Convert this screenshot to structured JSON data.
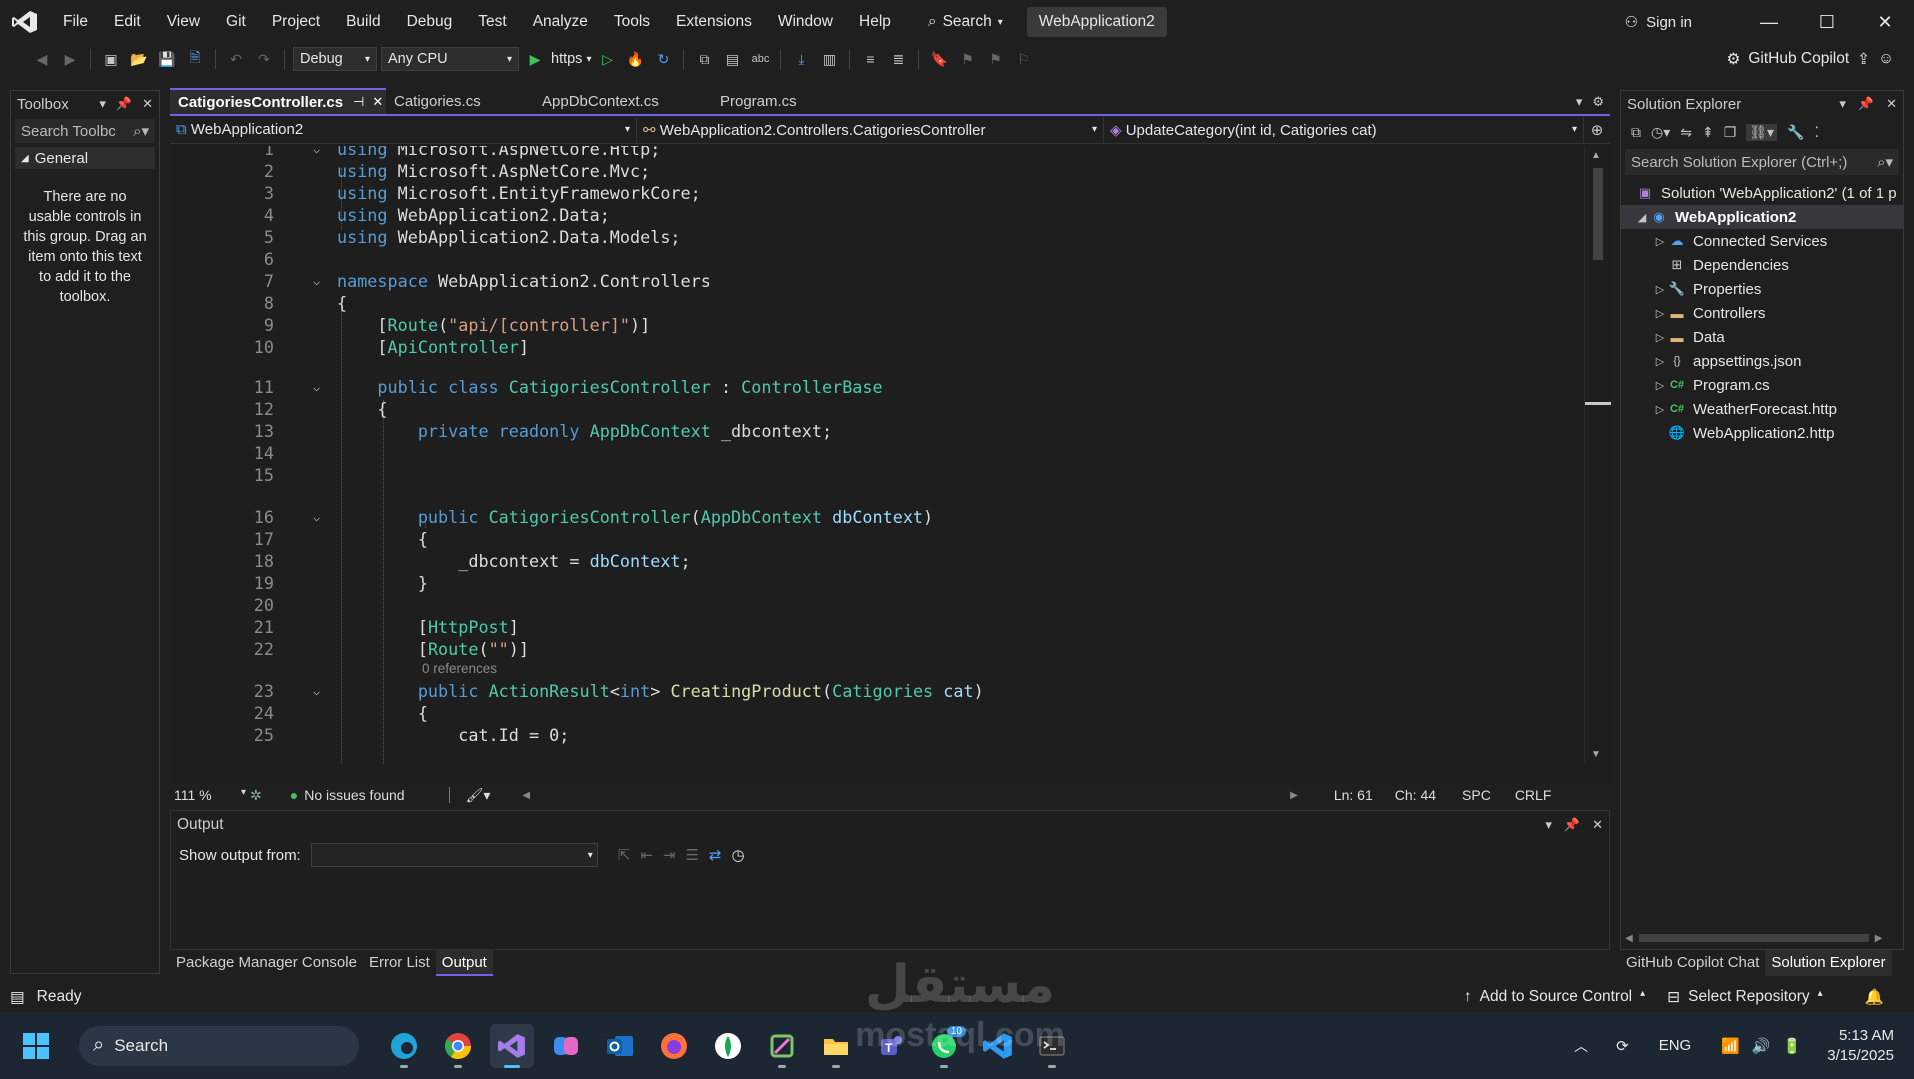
{
  "menu": [
    "File",
    "Edit",
    "View",
    "Git",
    "Project",
    "Build",
    "Debug",
    "Test",
    "Analyze",
    "Tools",
    "Extensions",
    "Window",
    "Help"
  ],
  "title_search": "Search",
  "solution_name": "WebApplication2",
  "sign_in": "Sign in",
  "toolbar": {
    "config": "Debug",
    "platform": "Any CPU",
    "run_target": "https",
    "copilot": "GitHub Copilot"
  },
  "toolbox": {
    "title": "Toolbox",
    "search_placeholder": "Search Toolbc",
    "group": "General",
    "empty_text": "There are no usable controls in this group. Drag an item onto this text to add it to the toolbox."
  },
  "editor": {
    "tabs": [
      {
        "label": "CatigoriesController.cs",
        "active": true
      },
      {
        "label": "Catigories.cs",
        "active": false
      },
      {
        "label": "AppDbContext.cs",
        "active": false
      },
      {
        "label": "Program.cs",
        "active": false
      }
    ],
    "nav_project": "WebApplication2",
    "nav_class": "WebApplication2.Controllers.CatigoriesController",
    "nav_member": "UpdateCategory(int id, Catigories cat)",
    "codelens": "0 references",
    "status": {
      "zoom": "111 %",
      "issues": "No issues found",
      "line": "Ln: 61",
      "col": "Ch: 44",
      "spaces": "SPC",
      "eol": "CRLF"
    }
  },
  "output": {
    "title": "Output",
    "show_from_label": "Show output from:"
  },
  "bottom_tabs": [
    "Package Manager Console",
    "Error List",
    "Output"
  ],
  "solution_explorer": {
    "title": "Solution Explorer",
    "search_placeholder": "Search Solution Explorer (Ctrl+;)",
    "solution_row": "Solution 'WebApplication2' (1 of 1 p",
    "project": "WebApplication2",
    "items": [
      "Connected Services",
      "Dependencies",
      "Properties",
      "Controllers",
      "Data",
      "appsettings.json",
      "Program.cs",
      "WeatherForecast.http",
      "WebApplication2.http"
    ],
    "bottom_tabs": [
      "GitHub Copilot Chat",
      "Solution Explorer"
    ]
  },
  "app_status": {
    "ready": "Ready",
    "source_control": "Add to Source Control",
    "repository": "Select Repository"
  },
  "taskbar": {
    "search": "Search",
    "lang": "ENG",
    "time": "5:13 AM",
    "date": "3/15/2025",
    "whatsapp_badge": "10"
  },
  "watermark": {
    "arabic": "مستقل",
    "latin": "mostaql.com"
  },
  "colors": {
    "accent": "#7160e8",
    "keyword": "#569cd6",
    "type": "#4ec9b0",
    "string": "#d69d85"
  }
}
